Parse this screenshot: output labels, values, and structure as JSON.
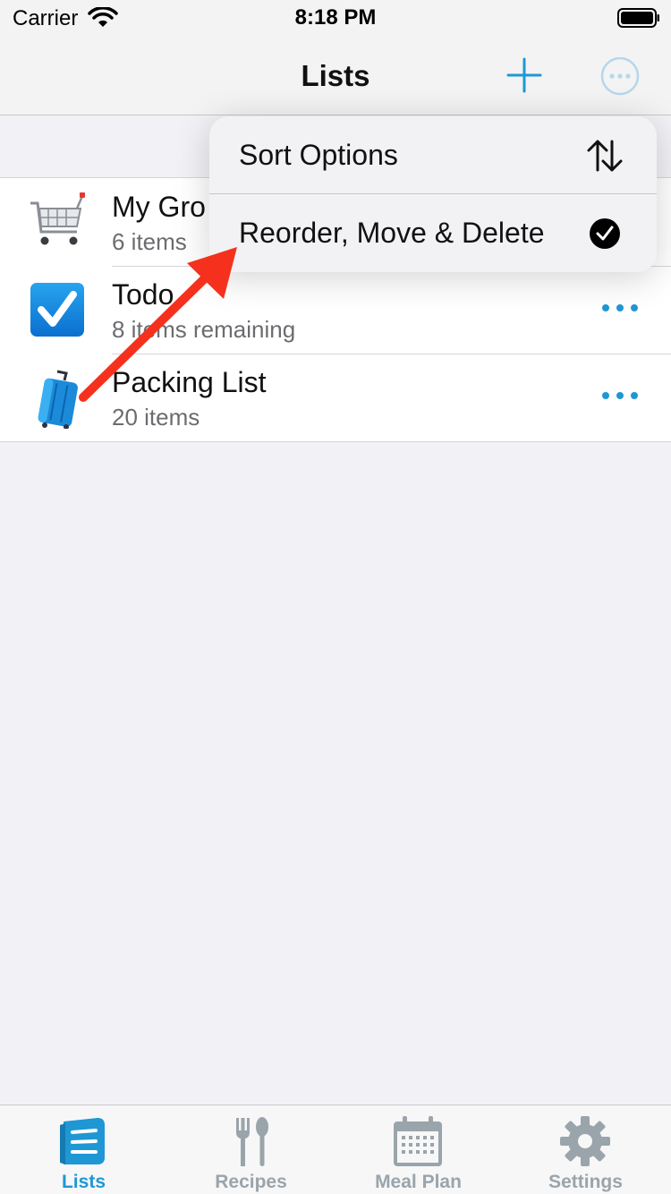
{
  "status_bar": {
    "carrier": "Carrier",
    "time": "8:18 PM"
  },
  "nav": {
    "title": "Lists",
    "add_icon": "plus-icon",
    "more_icon": "ellipsis-circle-icon"
  },
  "lists": [
    {
      "icon": "shopping-cart-icon",
      "title": "My Gro",
      "subtitle": "6 items"
    },
    {
      "icon": "checkbox-icon",
      "title": "Todo",
      "subtitle": "8 items remaining"
    },
    {
      "icon": "luggage-icon",
      "title": "Packing List",
      "subtitle": "20 items"
    }
  ],
  "menu": {
    "sort_label": "Sort Options",
    "sort_icon": "sort-arrows-icon",
    "reorder_label": "Reorder, Move & Delete",
    "reorder_icon": "checkmark-circle-icon"
  },
  "tabs": [
    {
      "label": "Lists",
      "icon": "lists-icon",
      "active": true
    },
    {
      "label": "Recipes",
      "icon": "fork-spoon-icon",
      "active": false
    },
    {
      "label": "Meal Plan",
      "icon": "calendar-icon",
      "active": false
    },
    {
      "label": "Settings",
      "icon": "gear-icon",
      "active": false
    }
  ],
  "colors": {
    "accent": "#1f97d4",
    "annotation_arrow": "#f5311d",
    "background": "#f2f2f6",
    "inactive_tab": "#9aa4ab"
  }
}
